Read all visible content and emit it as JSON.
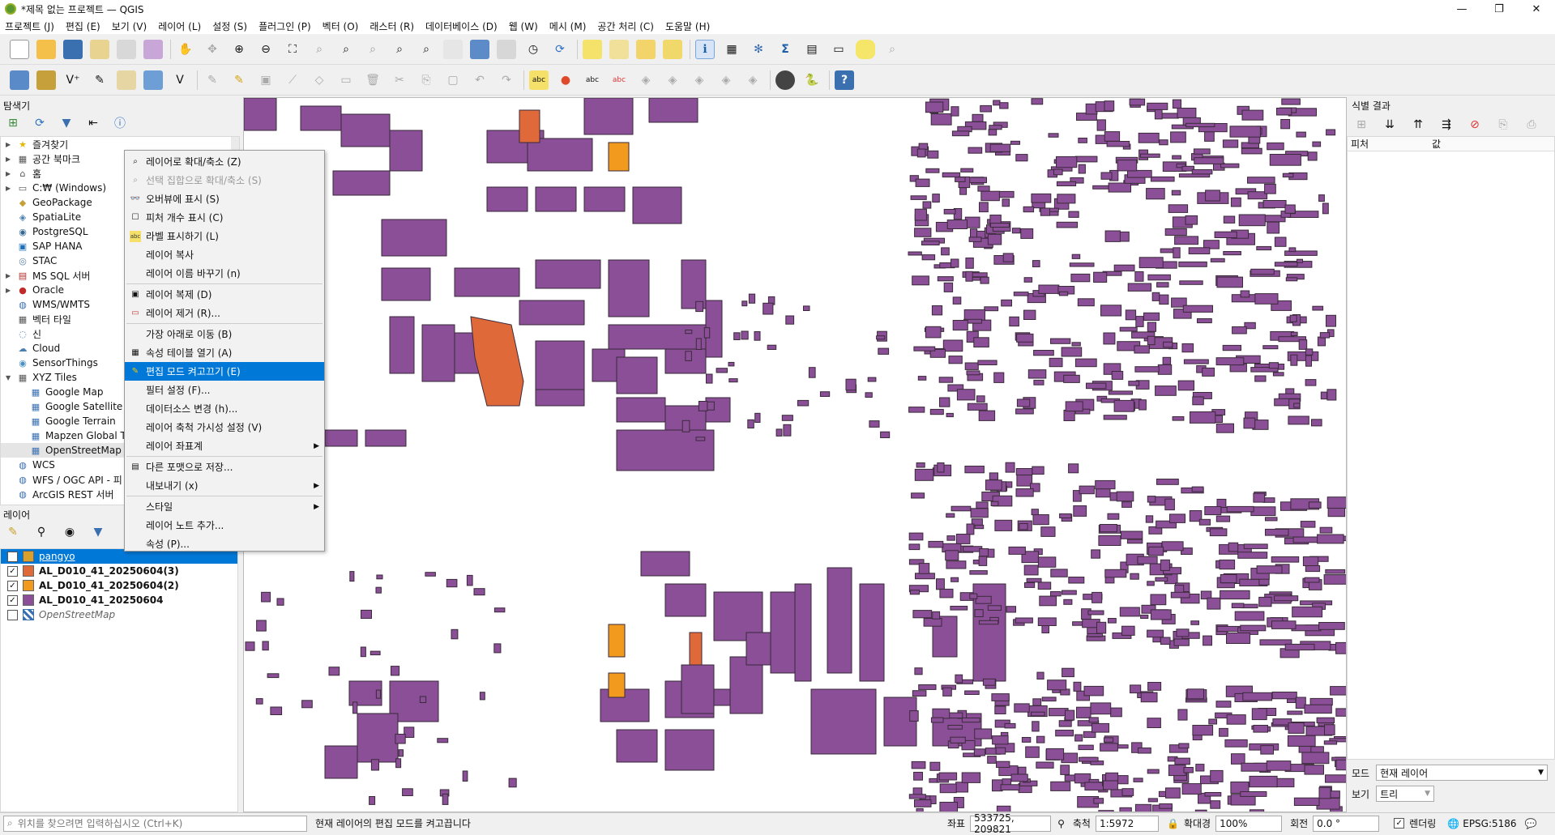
{
  "window": {
    "title": "*제목 없는 프로젝트 — QGIS"
  },
  "menu": [
    "프로젝트 (J)",
    "편집 (E)",
    "보기 (V)",
    "레이어 (L)",
    "설정 (S)",
    "플러그인 (P)",
    "벡터 (O)",
    "래스터 (R)",
    "데이터베이스 (D)",
    "웹 (W)",
    "메시 (M)",
    "공간 처리 (C)",
    "도움말 (H)"
  ],
  "browser": {
    "title": "탐색기",
    "items": [
      {
        "label": "즐겨찾기",
        "icon": "star-icon",
        "arrow": true
      },
      {
        "label": "공간 북마크",
        "icon": "bookmark-icon",
        "arrow": true
      },
      {
        "label": "홈",
        "icon": "home-icon",
        "arrow": true
      },
      {
        "label": "C:₩ (Windows)",
        "icon": "drive-icon",
        "arrow": true
      },
      {
        "label": "GeoPackage",
        "icon": "geopackage-icon",
        "arrow": false
      },
      {
        "label": "SpatiaLite",
        "icon": "spatialite-icon",
        "arrow": false
      },
      {
        "label": "PostgreSQL",
        "icon": "postgresql-icon",
        "arrow": false
      },
      {
        "label": "SAP HANA",
        "icon": "saphana-icon",
        "arrow": false
      },
      {
        "label": "STAC",
        "icon": "stac-icon",
        "arrow": false
      },
      {
        "label": "MS SQL 서버",
        "icon": "mssql-icon",
        "arrow": true
      },
      {
        "label": "Oracle",
        "icon": "oracle-icon",
        "arrow": true
      },
      {
        "label": "WMS/WMTS",
        "icon": "wms-icon",
        "arrow": false
      },
      {
        "label": "벡터 타일",
        "icon": "vector-tile-icon",
        "arrow": false
      },
      {
        "label": "신",
        "icon": "scene-icon",
        "arrow": false
      },
      {
        "label": "Cloud",
        "icon": "cloud-icon",
        "arrow": false
      },
      {
        "label": "SensorThings",
        "icon": "sensorthings-icon",
        "arrow": false
      },
      {
        "label": "XYZ Tiles",
        "icon": "xyz-icon",
        "arrow": true,
        "expanded": true
      },
      {
        "label": "Google Map",
        "icon": "tile-grid-icon",
        "child": true
      },
      {
        "label": "Google Satellite",
        "icon": "tile-grid-icon",
        "child": true
      },
      {
        "label": "Google Terrain",
        "icon": "tile-grid-icon",
        "child": true
      },
      {
        "label": "Mapzen Global Te",
        "icon": "tile-grid-icon",
        "child": true
      },
      {
        "label": "OpenStreetMap",
        "icon": "tile-grid-icon",
        "child": true,
        "selected": true
      },
      {
        "label": "WCS",
        "icon": "wcs-icon",
        "arrow": false
      },
      {
        "label": "WFS / OGC API - 피",
        "icon": "wfs-icon",
        "arrow": false
      },
      {
        "label": "ArcGIS REST 서버",
        "icon": "arcgis-icon",
        "arrow": false
      }
    ]
  },
  "layers": {
    "title": "레이어",
    "items": [
      {
        "name": "pangyo",
        "color": "#d9a02c",
        "checked": true,
        "selected": true
      },
      {
        "name": "AL_D010_41_20250604(3)",
        "color": "#e0693a",
        "checked": true
      },
      {
        "name": "AL_D010_41_20250604(2)",
        "color": "#f29a1d",
        "checked": true
      },
      {
        "name": "AL_D010_41_20250604",
        "color": "#8a4f96",
        "checked": true
      },
      {
        "name": "OpenStreetMap",
        "color": "",
        "checked": false,
        "italic": true
      }
    ]
  },
  "context_menu": {
    "items": [
      {
        "label": "레이어로 확대/축소 (Z)",
        "icon": "zoom-layer-icon"
      },
      {
        "label": "선택 집합으로 확대/축소 (S)",
        "icon": "zoom-selection-icon",
        "disabled": true
      },
      {
        "label": "오버뷰에 표시 (S)",
        "icon": "overview-icon"
      },
      {
        "label": "피처 개수 표시 (C)",
        "icon": "checkbox-icon"
      },
      {
        "label": "라벨 표시하기 (L)",
        "icon": "label-icon"
      },
      {
        "label": "레이어 복사",
        "icon": ""
      },
      {
        "label": "레이어 이름 바꾸기 (n)",
        "icon": ""
      },
      {
        "sep": true
      },
      {
        "label": "레이어 복제 (D)",
        "icon": "duplicate-icon"
      },
      {
        "label": "레이어 제거 (R)...",
        "icon": "remove-layer-icon"
      },
      {
        "sep": true
      },
      {
        "label": "가장 아래로 이동 (B)",
        "icon": ""
      },
      {
        "label": "속성 테이블 열기 (A)",
        "icon": "table-icon"
      },
      {
        "label": "편집 모드 켜고끄기 (E)",
        "icon": "pencil-icon",
        "highlight": true
      },
      {
        "label": "필터 설정 (F)...",
        "icon": ""
      },
      {
        "label": "데이터소스 변경 (h)...",
        "icon": ""
      },
      {
        "label": "레이어 축척 가시성 설정 (V)",
        "icon": ""
      },
      {
        "label": "레이어 좌표계",
        "icon": "",
        "submenu": true
      },
      {
        "sep": true
      },
      {
        "label": "다른 포맷으로 저장...",
        "icon": "save-as-icon"
      },
      {
        "label": "내보내기 (x)",
        "icon": "",
        "submenu": true
      },
      {
        "sep": true
      },
      {
        "label": "스타일",
        "icon": "",
        "submenu": true
      },
      {
        "label": "레이어 노트 추가...",
        "icon": ""
      },
      {
        "label": "속성 (P)...",
        "icon": ""
      }
    ]
  },
  "identify": {
    "title": "식별 결과",
    "col_feature": "피처",
    "col_value": "값",
    "mode_label": "모드",
    "mode_value": "현재 레이어",
    "view_label": "보기",
    "view_value": "트리"
  },
  "status": {
    "locator_placeholder": "위치를 찾으려면 입력하십시오 (Ctrl+K)",
    "message": "현재 레이어의 편집 모드를 켜고끕니다",
    "coord_label": "좌표",
    "coord_value": "533725, 209821",
    "scale_label": "축척",
    "scale_value": "1:5972",
    "magnifier_label": "확대경",
    "magnifier_value": "100%",
    "rotation_label": "회전",
    "rotation_value": "0.0 °",
    "render_label": "렌더링",
    "crs_label": "EPSG:5186"
  },
  "colors": {
    "building": "#8a4f96",
    "building_orange": "#f29a1d",
    "building_red": "#e0693a",
    "highlight": "#0078d7"
  }
}
